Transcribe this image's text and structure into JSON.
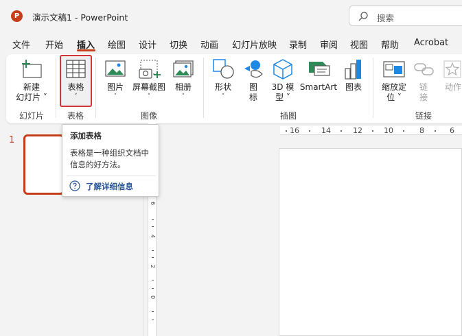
{
  "app": {
    "logo_letter": "P",
    "title": "演示文稿1  -  PowerPoint",
    "search_label": "搜索"
  },
  "menu": {
    "tabs": [
      "文件",
      "开始",
      "插入",
      "绘图",
      "设计",
      "切换",
      "动画",
      "幻灯片放映",
      "录制",
      "审阅",
      "视图",
      "帮助",
      "Acrobat"
    ],
    "active_tab": "插入"
  },
  "ribbon": {
    "new_slide": {
      "line1": "新建",
      "line2": "幻灯片 ˅"
    },
    "table": {
      "label": "表格",
      "chevron": "˅"
    },
    "picture": {
      "label": "图片",
      "chevron": "˅"
    },
    "screenshot": {
      "label": "屏幕截图",
      "chevron": "˅"
    },
    "album": {
      "label": "相册",
      "chevron": "˅"
    },
    "shapes": {
      "label": "形状",
      "chevron": "˅"
    },
    "icons": {
      "line1": "图",
      "line2": "标"
    },
    "model3d": {
      "line1": "3D 模",
      "line2": "型 ˅"
    },
    "smartart": {
      "label": "SmartArt"
    },
    "chart": {
      "label": "图表"
    },
    "zoom": {
      "line1": "缩放定",
      "line2": "位 ˅"
    },
    "link": {
      "line1": "链",
      "line2": "接"
    },
    "action": {
      "label": "动作"
    },
    "groups": {
      "slides": "幻灯片",
      "tables": "表格",
      "images": "图像",
      "illustrations": "插图",
      "links": "链接"
    }
  },
  "thumbnails": {
    "slide_number": "1"
  },
  "ruler": {
    "horizontal": [
      "16",
      "14",
      "12",
      "10",
      "8",
      "6"
    ],
    "vertical": [
      "6",
      "4",
      "2",
      "0"
    ]
  },
  "tooltip": {
    "title": "添加表格",
    "body": "表格是一种组织文档中信息的好方法。",
    "link": "了解详细信息"
  },
  "colors": {
    "accent": "#c43e1c",
    "highlight_border": "#d13438",
    "link": "#2b579a"
  }
}
